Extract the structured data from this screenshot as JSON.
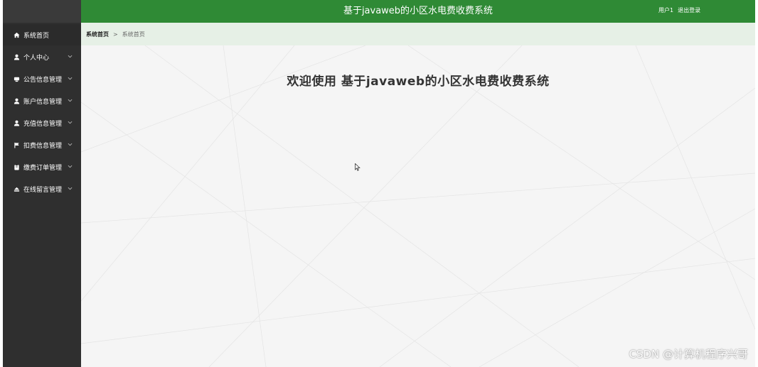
{
  "header": {
    "title": "基于javaweb的小区水电费收费系统",
    "user_label": "用户1",
    "logout_label": "退出登录",
    "bg_color": "#2f8a35"
  },
  "breadcrumb": {
    "root": "系统首页",
    "separator": ">",
    "current": "系统首页",
    "bg_color": "#e6f0e6"
  },
  "sidebar": {
    "bg_color": "#2f2f2f",
    "items": [
      {
        "label": "系统首页",
        "icon": "home-icon",
        "expandable": false
      },
      {
        "label": "个人中心",
        "icon": "user-icon",
        "expandable": true
      },
      {
        "label": "公告信息管理",
        "icon": "notice-icon",
        "expandable": true
      },
      {
        "label": "账户信息管理",
        "icon": "user-icon",
        "expandable": true
      },
      {
        "label": "充值信息管理",
        "icon": "user-icon",
        "expandable": true
      },
      {
        "label": "扣费信息管理",
        "icon": "flag-icon",
        "expandable": true
      },
      {
        "label": "缴费订单管理",
        "icon": "clipboard-icon",
        "expandable": true
      },
      {
        "label": "在线留言管理",
        "icon": "eject-icon",
        "expandable": true
      }
    ]
  },
  "main": {
    "welcome": "欢迎使用 基于javaweb的小区水电费收费系统"
  },
  "watermark": "CSDN @计算机程序兴哥"
}
